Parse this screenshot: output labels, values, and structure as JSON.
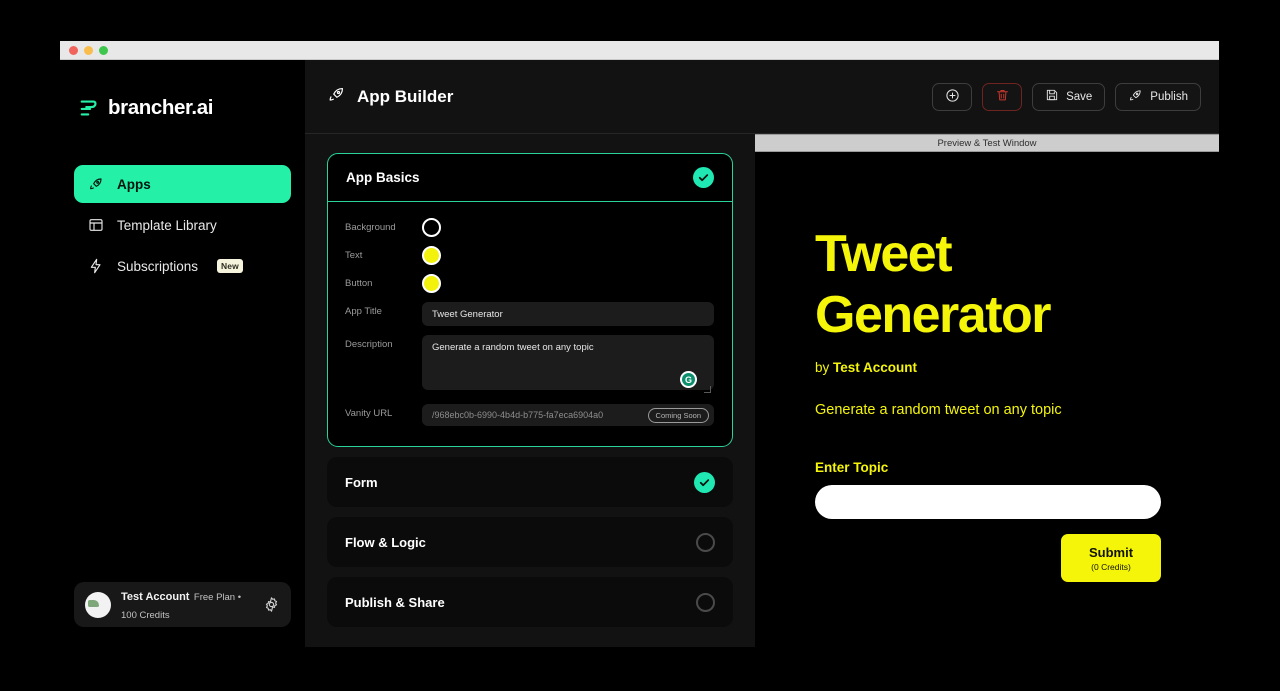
{
  "brand": {
    "name": "brancher.ai"
  },
  "sidebar": {
    "items": [
      {
        "label": "Apps",
        "icon": "rocket-icon",
        "active": true
      },
      {
        "label": "Template Library",
        "icon": "layout-icon",
        "active": false
      },
      {
        "label": "Subscriptions",
        "icon": "bolt-icon",
        "active": false,
        "badge": "New"
      }
    ],
    "profile": {
      "name": "Test Account",
      "plan": "Free Plan • 100 Credits",
      "settings_icon": "gear-icon"
    }
  },
  "header": {
    "title": "App Builder",
    "icon": "rocket-icon",
    "buttons": [
      {
        "label": "",
        "icon": "plus-circle-icon",
        "name": "add-button"
      },
      {
        "label": "",
        "icon": "trash-icon",
        "name": "delete-button"
      },
      {
        "label": "Save",
        "icon": "floppy-disk-icon",
        "name": "save-button"
      },
      {
        "label": "Publish",
        "icon": "rocket-icon",
        "name": "publish-button"
      }
    ]
  },
  "builder": {
    "app_basics": {
      "title": "App Basics",
      "status": "complete",
      "fields": {
        "background_label": "Background",
        "background_color": "#000000",
        "text_label": "Text",
        "text_color": "#F2F20D",
        "button_label": "Button",
        "button_color": "#F2F20D",
        "app_title_label": "App Title",
        "app_title_value": "Tweet Generator",
        "app_title_placeholder": "App Title",
        "description_label": "Description",
        "description_value": "Generate a random tweet on any topic",
        "description_placeholder": "Description",
        "description_badge_icon": "grammarly-icon",
        "description_badge_letter": "G",
        "vanity_label": "Vanity URL",
        "vanity_value": "/968ebc0b-6990-4b4d-b775-fa7eca6904a0",
        "vanity_badge": "Coming Soon"
      }
    },
    "sections": [
      {
        "title": "Form",
        "status": "complete"
      },
      {
        "title": "Flow & Logic",
        "status": "incomplete"
      },
      {
        "title": "Publish & Share",
        "status": "incomplete"
      }
    ]
  },
  "preview": {
    "window_label": "Preview & Test Window",
    "title_line1": "Tweet",
    "title_line2": "Generator",
    "by_prefix": "by",
    "by_author": "Test Account",
    "description": "Generate a random tweet on any topic",
    "input_label": "Enter Topic",
    "input_value": "",
    "input_placeholder": "",
    "submit_label": "Submit",
    "submit_credits": "(0 Credits)"
  },
  "colors": {
    "accent_mint": "#25F0A8",
    "accent_yellow": "#F5F50A",
    "danger": "#6E2420"
  }
}
